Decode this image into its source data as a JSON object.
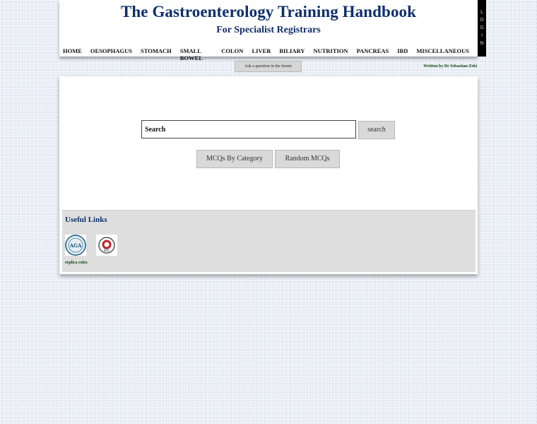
{
  "header": {
    "title": "The Gastroenterology Training Handbook",
    "subtitle": "For Specialist Registrars",
    "login_letters": [
      "L",
      "O",
      "G",
      "I",
      "N"
    ],
    "nav": [
      "HOME",
      "OESOPHAGUS",
      "STOMACH",
      "SMALL BOWEL",
      "COLON",
      "LIVER",
      "BILIARY",
      "NUTRITION",
      "PANCREAS",
      "IBD",
      "MISCELLANEOUS"
    ]
  },
  "subbar": {
    "ask_button": "Ask a question in the forum",
    "written_by": "Written by Dr Sebastian Zeki"
  },
  "search": {
    "value": "Search",
    "button": "search"
  },
  "mcq": {
    "by_category": "MCQs By Category",
    "random": "Random MCQs"
  },
  "useful_links": {
    "heading": "Useful Links",
    "logo1": "AGA",
    "logo2": "BSG",
    "link_text": "replica rolex"
  },
  "colors": {
    "title": "#0f2f6b",
    "page_bg": "#e9eef6",
    "panel_grey": "#dedede"
  }
}
